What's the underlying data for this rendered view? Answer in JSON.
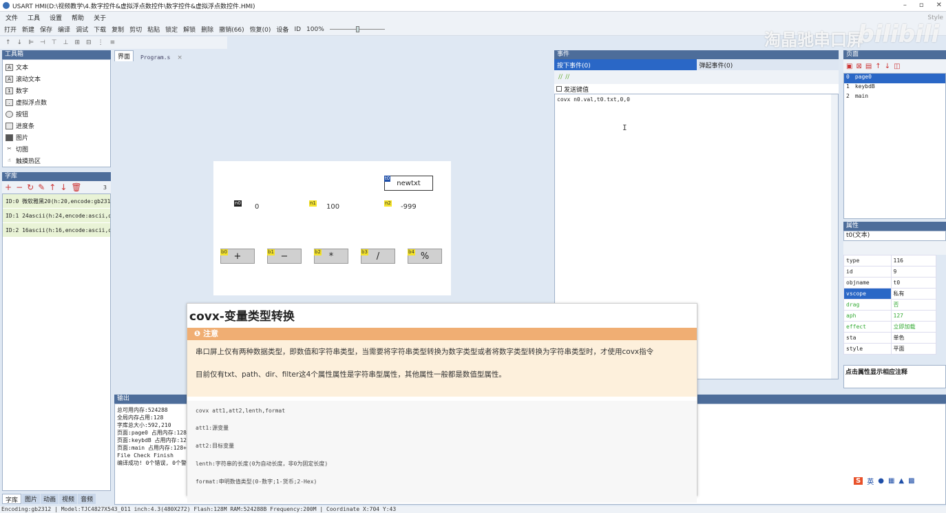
{
  "window": {
    "title": "USART HMI(D:\\视频教学\\4.数字控件&虚拟浮点数控件\\数字控件&虚拟浮点数控件.HMI)",
    "min": "–",
    "max": "▫",
    "close": "✕"
  },
  "menu": [
    "文件",
    "工具",
    "设置",
    "帮助",
    "关于"
  ],
  "toolbar": [
    "打开",
    "新建",
    "保存",
    "编译",
    "调试",
    "下载",
    "复制",
    "剪切",
    "粘贴",
    "锁定",
    "解锁",
    "删除",
    "撤销(66)",
    "恢复(0)",
    "设备",
    "ID",
    "100%"
  ],
  "toolbar_style": "Style",
  "watermark": {
    "text": "淘晶驰串口屏",
    "brand": "bilibili"
  },
  "toolbox": {
    "title": "工具箱",
    "items": [
      "文本",
      "滚动文本",
      "数字",
      "虚拟浮点数",
      "按钮",
      "进度条",
      "图片",
      "切图",
      "触摸热区"
    ]
  },
  "fontlib": {
    "title": "字库",
    "count": "3",
    "rows": [
      "ID:0  微软雅黑20(h:20,encode:gb2312",
      "ID:1  24ascii(h:24,encode:ascii,qty:",
      "ID:2  16ascii(h:16,encode:ascii,qty:"
    ]
  },
  "bottom_tabs": [
    "字库",
    "图片",
    "动画",
    "视频",
    "音频"
  ],
  "editor_tabs": [
    "界面",
    "Program.s"
  ],
  "screen": {
    "t0_badge": "t0",
    "t0_text": "newtxt",
    "n0_badge": "n0",
    "n0_val": "0",
    "n1_badge": "n1",
    "n1_val": "100",
    "n2_badge": "n2",
    "n2_val": "-999",
    "buttons": [
      {
        "badge": "b0",
        "label": "+"
      },
      {
        "badge": "b1",
        "label": "−"
      },
      {
        "badge": "b2",
        "label": "*"
      },
      {
        "badge": "b3",
        "label": "/"
      },
      {
        "badge": "b4",
        "label": "%"
      }
    ]
  },
  "events": {
    "title": "事件",
    "tab_press": "按下事件(0)",
    "tab_release": "弹起事件(0)",
    "send_key": "发送键值",
    "code": "covx n0.val,t0.txt,0,0"
  },
  "pages": {
    "title": "页面",
    "items": [
      {
        "idx": "0",
        "name": "page0"
      },
      {
        "idx": "1",
        "name": "keybdB"
      },
      {
        "idx": "2",
        "name": "main"
      }
    ]
  },
  "properties": {
    "title": "属性",
    "selected": "t0(文本)",
    "rows": [
      {
        "k": "type",
        "v": "116"
      },
      {
        "k": "id",
        "v": "9"
      },
      {
        "k": "objname",
        "v": "t0"
      },
      {
        "k": "vscope",
        "v": "私有"
      },
      {
        "k": "drag",
        "v": "否"
      },
      {
        "k": "aph",
        "v": "127"
      },
      {
        "k": "effect",
        "v": "立即加载"
      },
      {
        "k": "sta",
        "v": "单色"
      },
      {
        "k": "style",
        "v": "平面"
      }
    ],
    "hint": "点击属性显示相应注释"
  },
  "output": {
    "title": "输出",
    "lines": [
      "总可用内存:524288",
      "全局内存占用:128",
      "字库总大小:592,210",
      "页面:page0 占用内存:128+",
      "页面:keybdB 占用内存:128",
      "页面:main 占用内存:128+1",
      "File Check Finish",
      "编译成功! 0个错误, 0个警"
    ]
  },
  "tooltip": {
    "title": "covx-变量类型转换",
    "note_label": "注意",
    "note_lines": [
      "串口屏上仅有两种数据类型，即数值和字符串类型，当需要将字符串类型转换为数字类型或者将数字类型转换为字符串类型时，才使用covx指令",
      "目前仅有txt、path、dir、filter这4个属性属性是字符串型属性，其他属性一般都是数值型属性。"
    ],
    "syntax": [
      "covx att1,att2,lenth,format",
      "att1:源变量",
      "att2:目标变量",
      "lenth:字符串的长度(0为自动长度，非0为固定长度)",
      "format:申明数值类型(0-数字;1-货币;2-Hex)"
    ]
  },
  "status": "Encoding:gb2312  | Model:TJC4827X543_011  inch:4.3(480X272) Flash:128M RAM:524288B Frequency:200M   |  Coordinate X:704  Y:43",
  "player_label": "英"
}
